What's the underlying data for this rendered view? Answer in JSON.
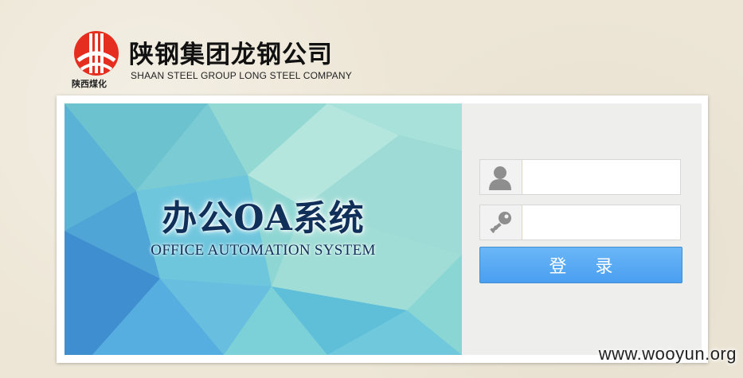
{
  "header": {
    "company_cn": "陕钢集团龙钢公司",
    "company_en": "SHAAN STEEL GROUP LONG STEEL COMPANY",
    "logo_caption": "陕西煤化",
    "logo_icon": "shaanxi-coal-chemical-logo",
    "logo_color": "#e52e1f"
  },
  "banner": {
    "title": "办公OA系统",
    "subtitle": "OFFICE AUTOMATION SYSTEM"
  },
  "login": {
    "username": {
      "icon": "user-icon",
      "value": "",
      "placeholder": ""
    },
    "password": {
      "icon": "key-icon",
      "value": "",
      "placeholder": ""
    },
    "submit_label": "登录",
    "button_color": "#5aa9f2"
  },
  "watermark": "www.wooyun.org"
}
